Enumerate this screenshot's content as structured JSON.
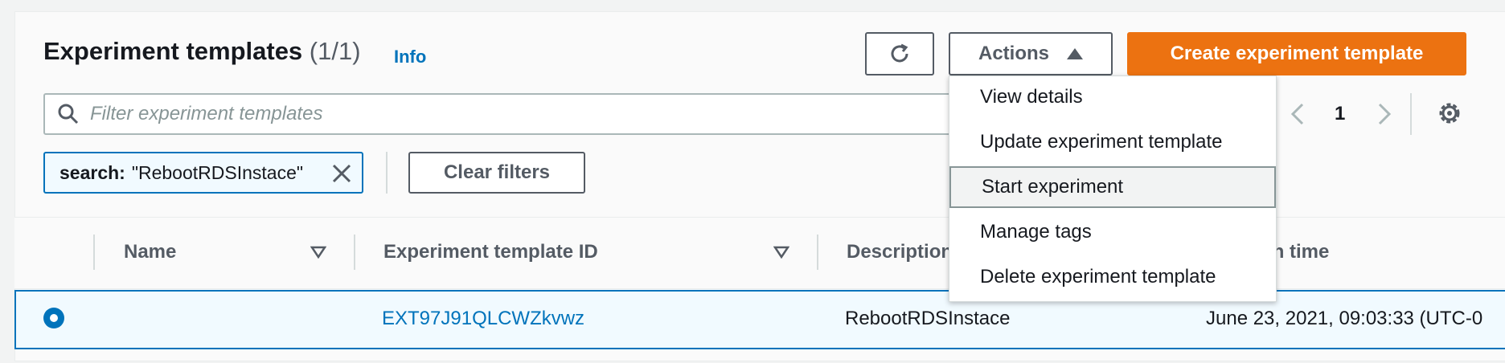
{
  "header": {
    "title": "Experiment templates",
    "count": "(1/1)",
    "info_link": "Info",
    "actions_label": "Actions",
    "create_label": "Create experiment template"
  },
  "filter": {
    "placeholder": "Filter experiment templates",
    "token_key": "search:",
    "token_value": "\"RebootRDSInstace\"",
    "clear_label": "Clear filters"
  },
  "pagination": {
    "page": "1"
  },
  "table": {
    "columns": [
      "Name",
      "Experiment template ID",
      "Description",
      "Creation time"
    ],
    "rows": [
      {
        "selected": true,
        "name": "",
        "id": "EXT97J91QLCWZkvwz",
        "description": "RebootRDSInstace",
        "creation_time": "June 23, 2021, 09:03:33 (UTC-0"
      }
    ]
  },
  "actions_menu": {
    "items": [
      "View details",
      "Update experiment template",
      "Start experiment",
      "Manage tags",
      "Delete experiment template"
    ],
    "hovered": "Start experiment"
  },
  "colors": {
    "accent": "#0073bb",
    "primary_button": "#ec7211"
  },
  "icons": [
    "refresh-icon",
    "caret-up-icon",
    "search-icon",
    "chevron-left-icon",
    "chevron-right-icon",
    "gear-icon",
    "close-icon",
    "sort-caret-icon",
    "radio-selected-icon"
  ]
}
